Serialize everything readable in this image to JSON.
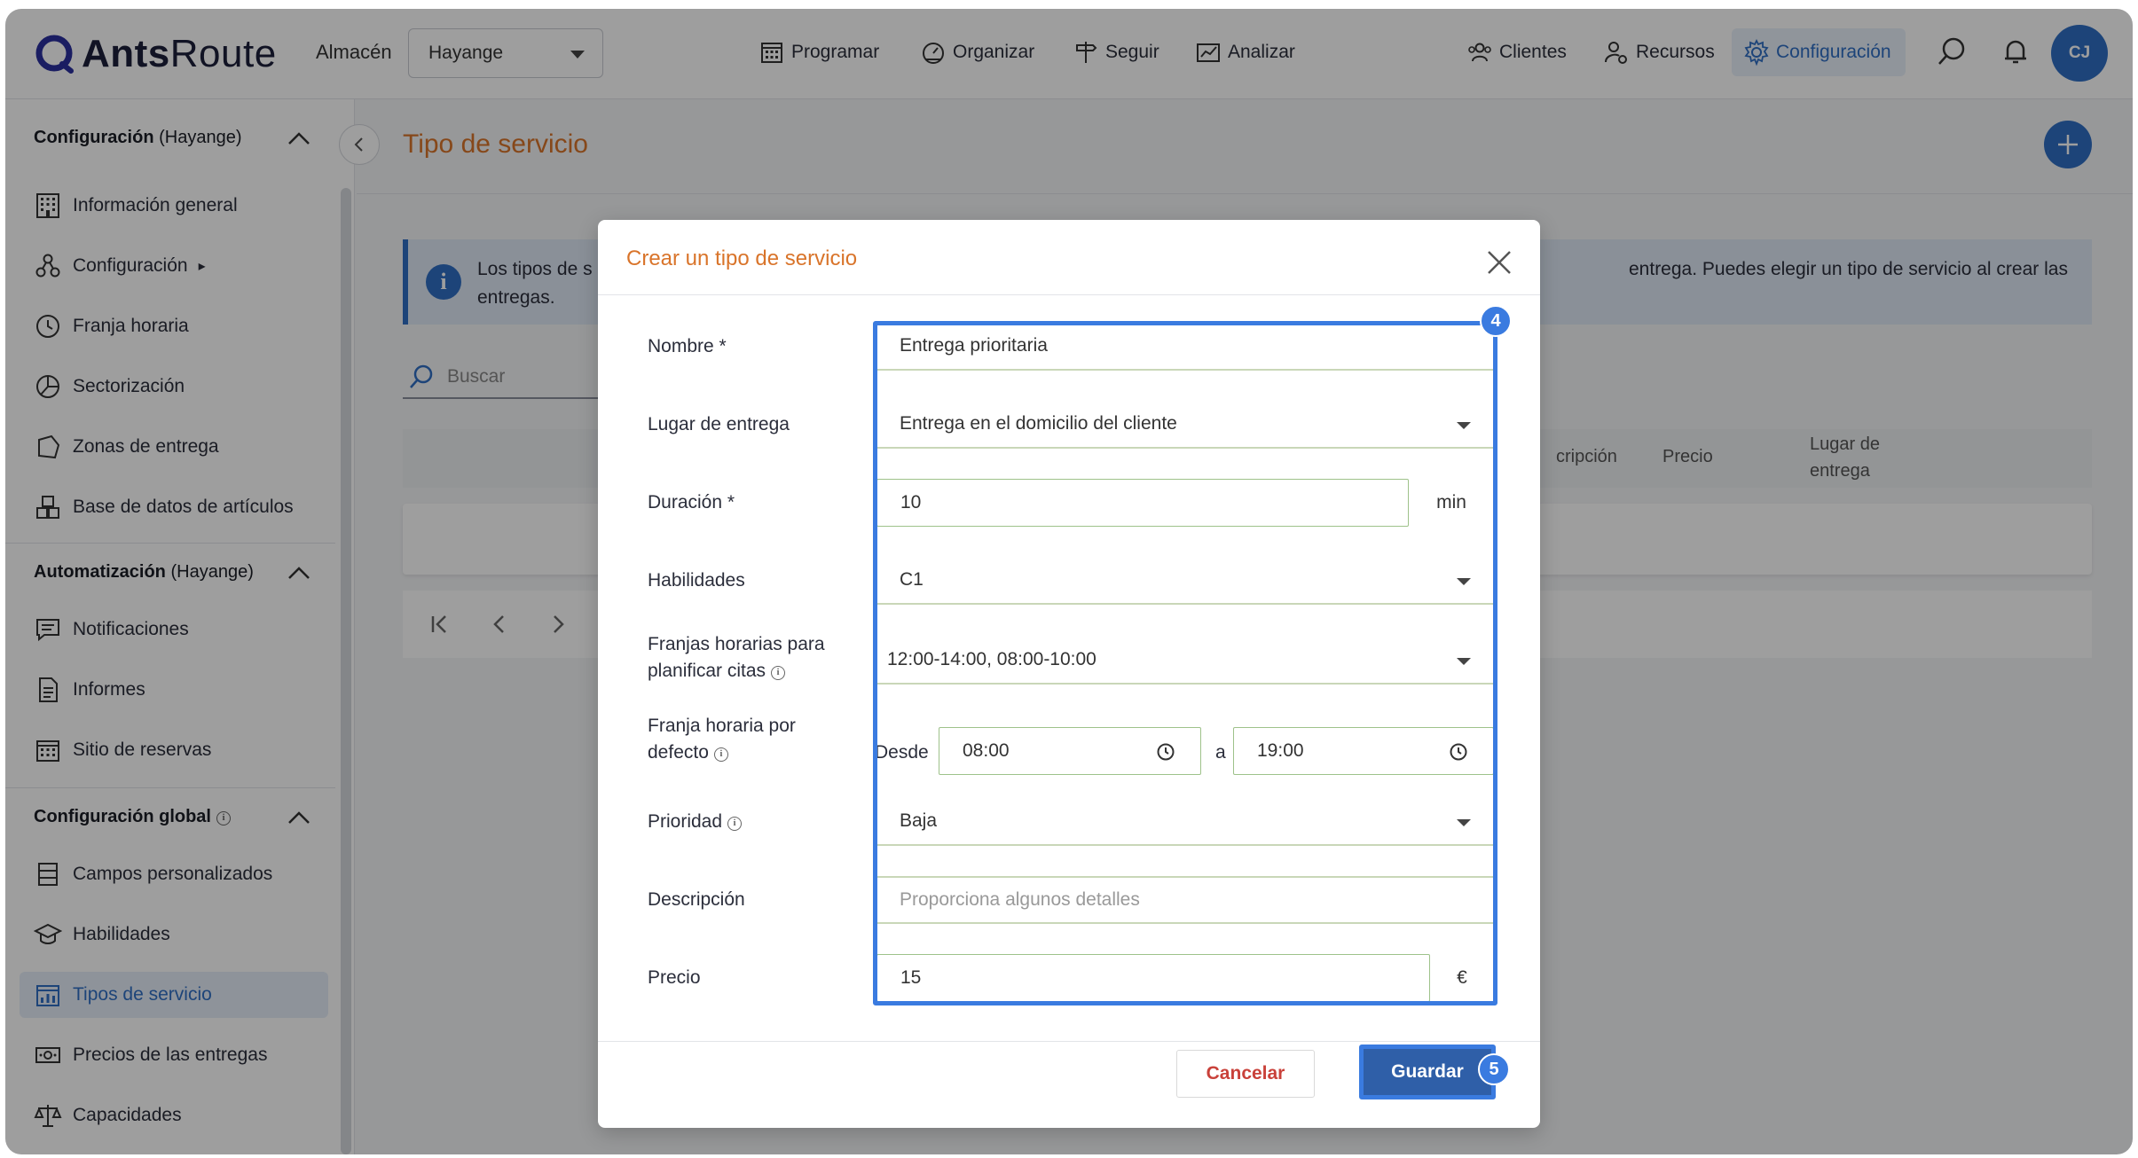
{
  "app": {
    "logo_prefix": "Ants",
    "logo_suffix": "Route",
    "warehouse_label": "Almacén",
    "warehouse_value": "Hayange",
    "avatar_initials": "CJ",
    "accent_color": "#2f6fc4",
    "title_color": "#d9742a"
  },
  "nav": {
    "programar": "Programar",
    "organizar": "Organizar",
    "seguir": "Seguir",
    "analizar": "Analizar",
    "clientes": "Clientes",
    "recursos": "Recursos",
    "configuracion": "Configuración"
  },
  "sidebar": {
    "section1_title": "Configuración",
    "section1_wh": "(Hayange)",
    "section1_items": [
      {
        "label": "Información general",
        "icon": "building-icon"
      },
      {
        "label": "Configuración",
        "icon": "cubes-icon"
      },
      {
        "label": "Franja horaria",
        "icon": "clock-icon"
      },
      {
        "label": "Sectorización",
        "icon": "pie-chart-icon"
      },
      {
        "label": "Zonas de entrega",
        "icon": "polygon-icon"
      },
      {
        "label": "Base de datos de artículos",
        "icon": "boxes-icon"
      }
    ],
    "config_arrow": "▸",
    "section2_title": "Automatización",
    "section2_wh": "(Hayange)",
    "section2_items": [
      {
        "label": "Notificaciones",
        "icon": "message-icon"
      },
      {
        "label": "Informes",
        "icon": "document-icon"
      },
      {
        "label": "Sitio de reservas",
        "icon": "calendar-icon"
      }
    ],
    "section3_title": "Configuración global",
    "section3_items": [
      {
        "label": "Campos personalizados",
        "icon": "list-icon"
      },
      {
        "label": "Habilidades",
        "icon": "graduation-cap-icon"
      },
      {
        "label": "Tipos de servicio",
        "icon": "chart-calendar-icon"
      },
      {
        "label": "Precios de las entregas",
        "icon": "money-icon"
      },
      {
        "label": "Capacidades",
        "icon": "scale-icon"
      }
    ]
  },
  "page": {
    "title": "Tipo de servicio",
    "info_text_left": "Los tipos de s",
    "info_text_right": "entrega. Puedes elegir un tipo de servicio al crear las",
    "info_text_line2": "entregas.",
    "search_placeholder": "Buscar",
    "columns": [
      "cripción",
      "Precio",
      "Lugar de entrega"
    ]
  },
  "modal": {
    "title": "Crear un tipo de servicio",
    "fields": {
      "nombre_label": "Nombre *",
      "nombre_value": "Entrega prioritaria",
      "lugar_label": "Lugar de entrega",
      "lugar_value": "Entrega en el domicilio del cliente",
      "duracion_label": "Duración *",
      "duracion_value": "10",
      "duracion_unit": "min",
      "habilidades_label": "Habilidades",
      "habilidades_value": "C1",
      "franjas_label_1": "Franjas horarias para",
      "franjas_label_2": "planificar citas",
      "franjas_value": "12:00-14:00, 08:00-10:00",
      "defecto_label_1": "Franja horaria por",
      "defecto_label_2": "defecto",
      "desde_label": "Desde",
      "desde_value": "08:00",
      "a_label": "a",
      "hasta_value": "19:00",
      "prioridad_label": "Prioridad",
      "prioridad_value": "Baja",
      "descripcion_label": "Descripción",
      "descripcion_placeholder": "Proporciona algunos detalles",
      "precio_label": "Precio",
      "precio_value": "15",
      "precio_unit": "€"
    },
    "cancel_label": "Cancelar",
    "save_label": "Guardar",
    "badge_fields": "4",
    "badge_save": "5"
  }
}
